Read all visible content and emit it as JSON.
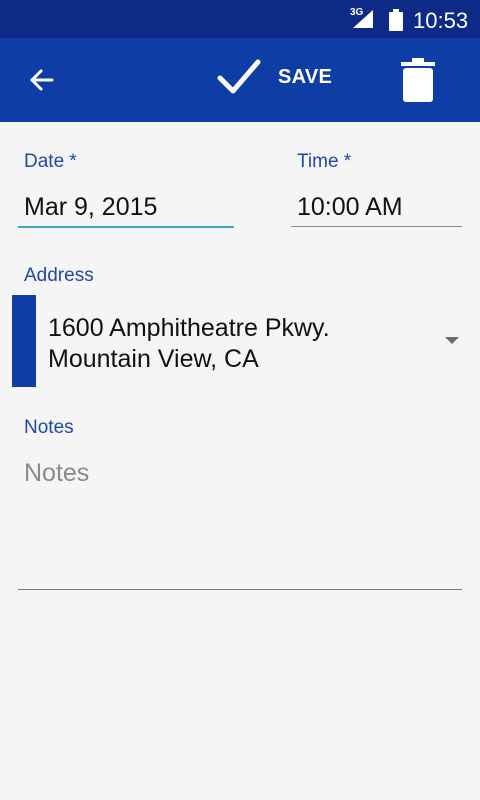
{
  "status_bar": {
    "network": "3G",
    "time": "10:53",
    "icons": [
      "signal-icon",
      "battery-icon"
    ]
  },
  "toolbar": {
    "back_icon": "arrow-left-icon",
    "save_icon": "check-icon",
    "save_label": "SAVE",
    "delete_icon": "trash-icon"
  },
  "form": {
    "date": {
      "label": "Date *",
      "value": "Mar 9, 2015"
    },
    "time": {
      "label": "Time *",
      "value": "10:00 AM"
    },
    "address": {
      "label": "Address",
      "line1": "1600 Amphitheatre Pkwy.",
      "line2": "Mountain View, CA"
    },
    "notes": {
      "label": "Notes",
      "placeholder": "Notes",
      "value": ""
    }
  },
  "colors": {
    "status_bar_bg": "#0d2b86",
    "toolbar_bg": "#0d3da5",
    "label": "#1f48a8",
    "focus_underline": "#3aa7c6",
    "background": "#f5f5f5"
  }
}
